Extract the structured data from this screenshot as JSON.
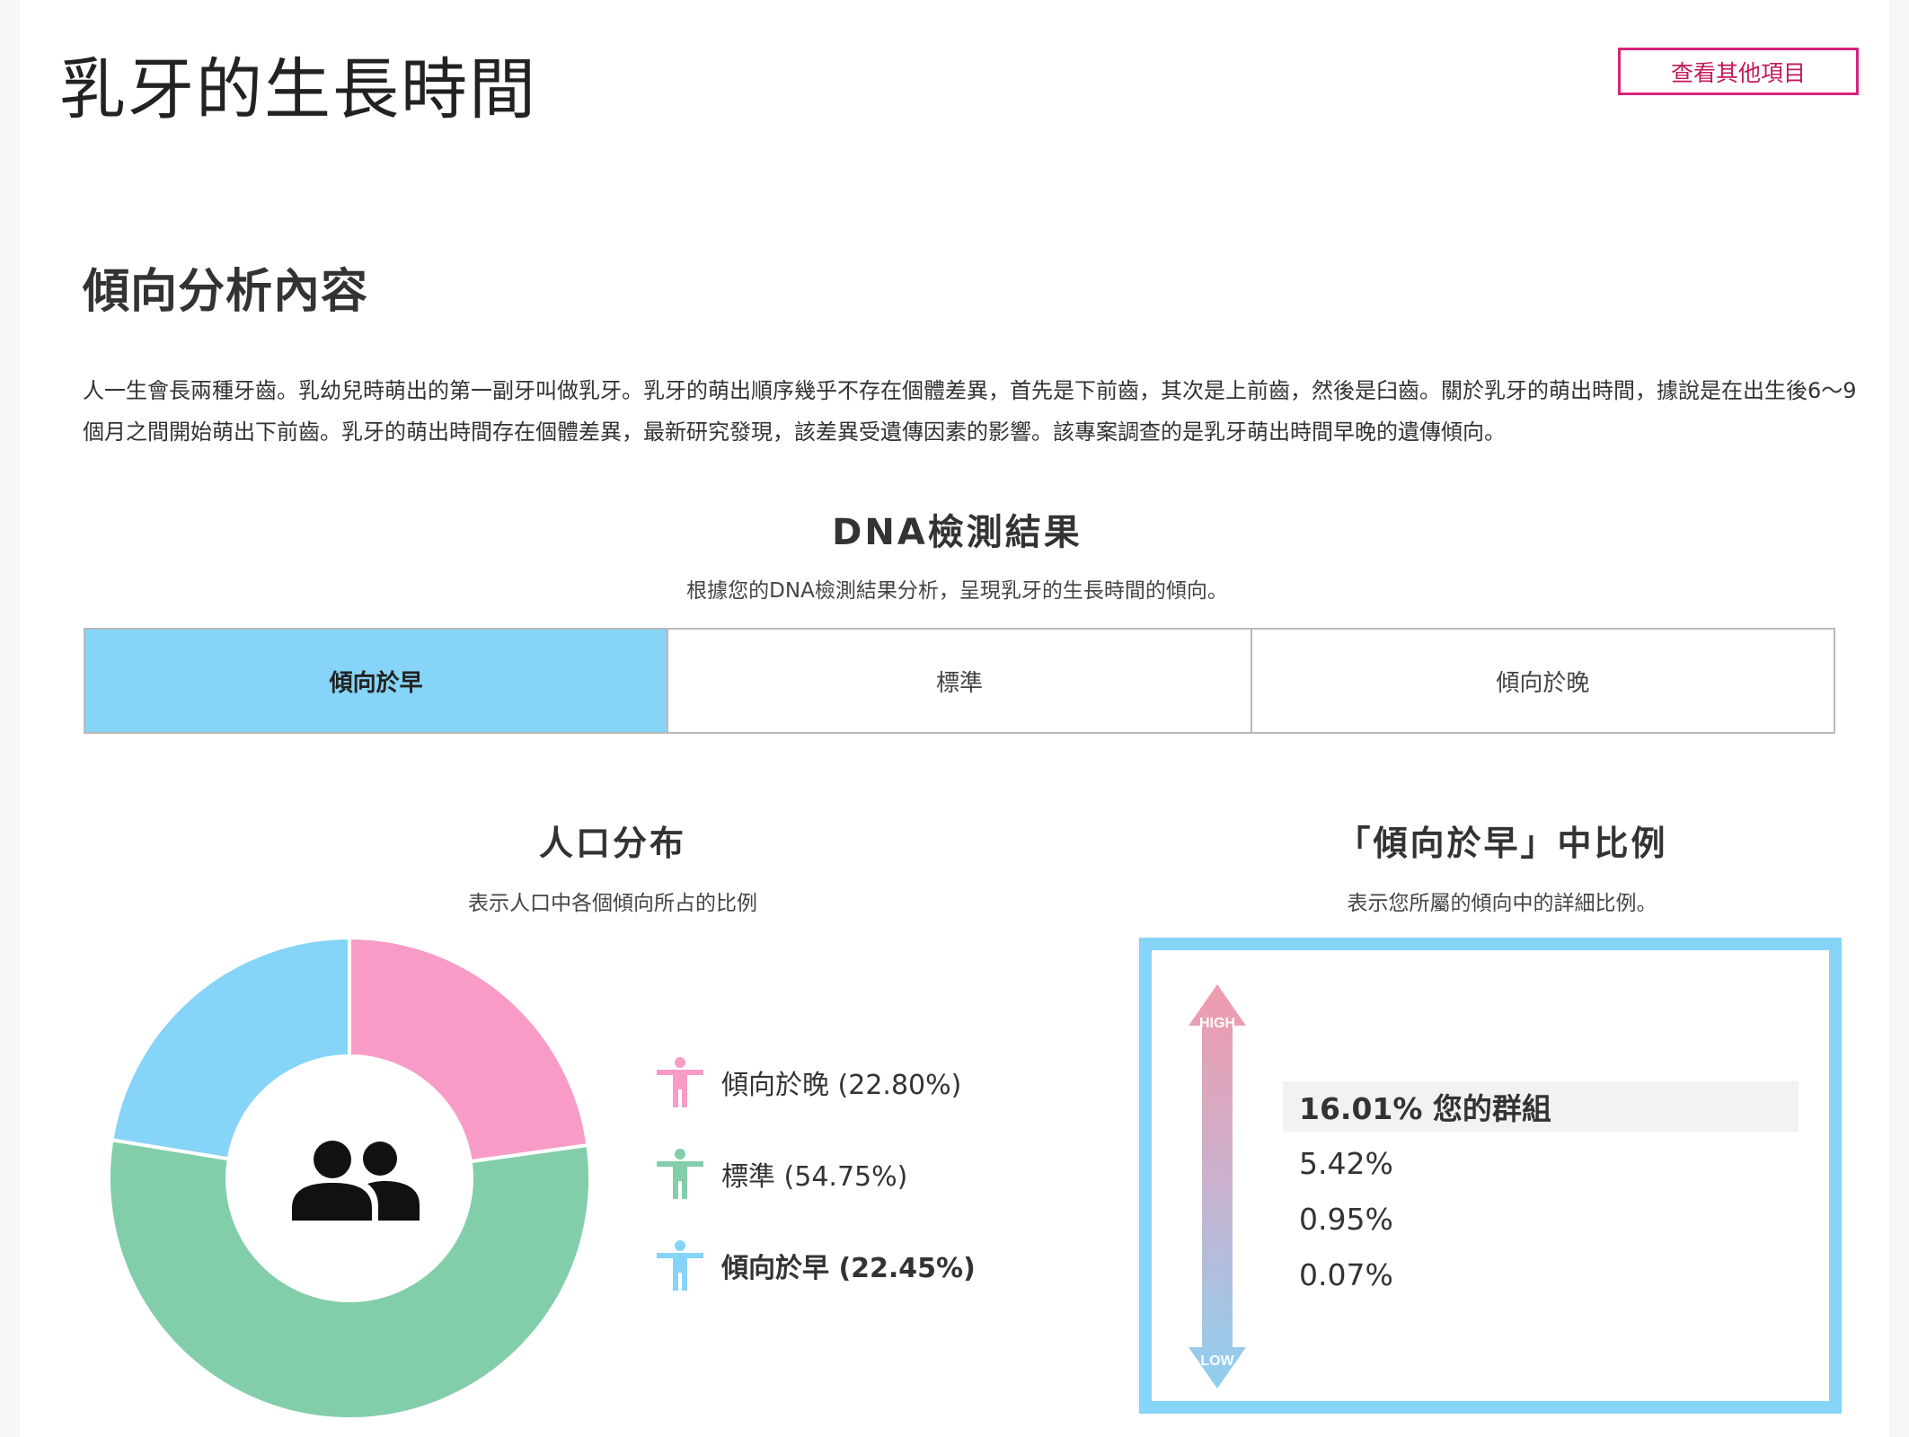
{
  "header": {
    "title": "乳牙的生長時間",
    "other_items_button": "查看其他項目"
  },
  "analysis": {
    "title": "傾向分析內容",
    "description": "人一生會長兩種牙齒。乳幼兒時萌出的第一副牙叫做乳牙。乳牙的萌出順序幾乎不存在個體差異，首先是下前齒，其次是上前齒，然後是臼齒。關於乳牙的萌出時間，據說是在出生後6～9個月之間開始萌出下前齒。乳牙的萌出時間存在個體差異，最新研究發現，該差異受遺傳因素的影響。該專案調查的是乳牙萌出時間早晚的遺傳傾向。"
  },
  "dna_result": {
    "title": "DNA檢測結果",
    "subtitle": "根據您的DNA檢測結果分析，呈現乳牙的生長時間的傾向。",
    "tendencies": [
      {
        "label": "傾向於早",
        "active": true
      },
      {
        "label": "標準",
        "active": false
      },
      {
        "label": "傾向於晚",
        "active": false
      }
    ]
  },
  "population": {
    "title": "人口分布",
    "subtitle": "表示人口中各個傾向所占的比例",
    "legend": [
      {
        "label": "傾向於晚 (22.80%)",
        "icon": "person-icon",
        "color": "#f89cc7",
        "bold": false
      },
      {
        "label": "標準 (54.75%)",
        "icon": "person-icon",
        "color": "#82cdaa",
        "bold": false
      },
      {
        "label": "傾向於早 (22.45%)",
        "icon": "person-icon",
        "color": "#86d4f7",
        "bold": true
      }
    ],
    "center_icon": "group-icon"
  },
  "chart_data": {
    "type": "pie",
    "donut": true,
    "categories": [
      "傾向於晚",
      "標準",
      "傾向於早"
    ],
    "values": [
      22.8,
      54.75,
      22.45
    ],
    "colors": [
      "#f89cc7",
      "#82cdaa",
      "#86d4f7"
    ],
    "start_angle_deg": 0,
    "direction": "clockwise"
  },
  "ratio": {
    "title": "「傾向於早」中比例",
    "subtitle": "表示您所屬的傾向中的詳細比例。",
    "arrow_high": "HIGH",
    "arrow_low": "LOW",
    "rows": [
      {
        "text": "16.01% 您的群組",
        "highlight": true
      },
      {
        "text": "5.42%",
        "highlight": false
      },
      {
        "text": "0.95%",
        "highlight": false
      },
      {
        "text": "0.07%",
        "highlight": false
      }
    ],
    "border_color": "#86d4f7"
  }
}
